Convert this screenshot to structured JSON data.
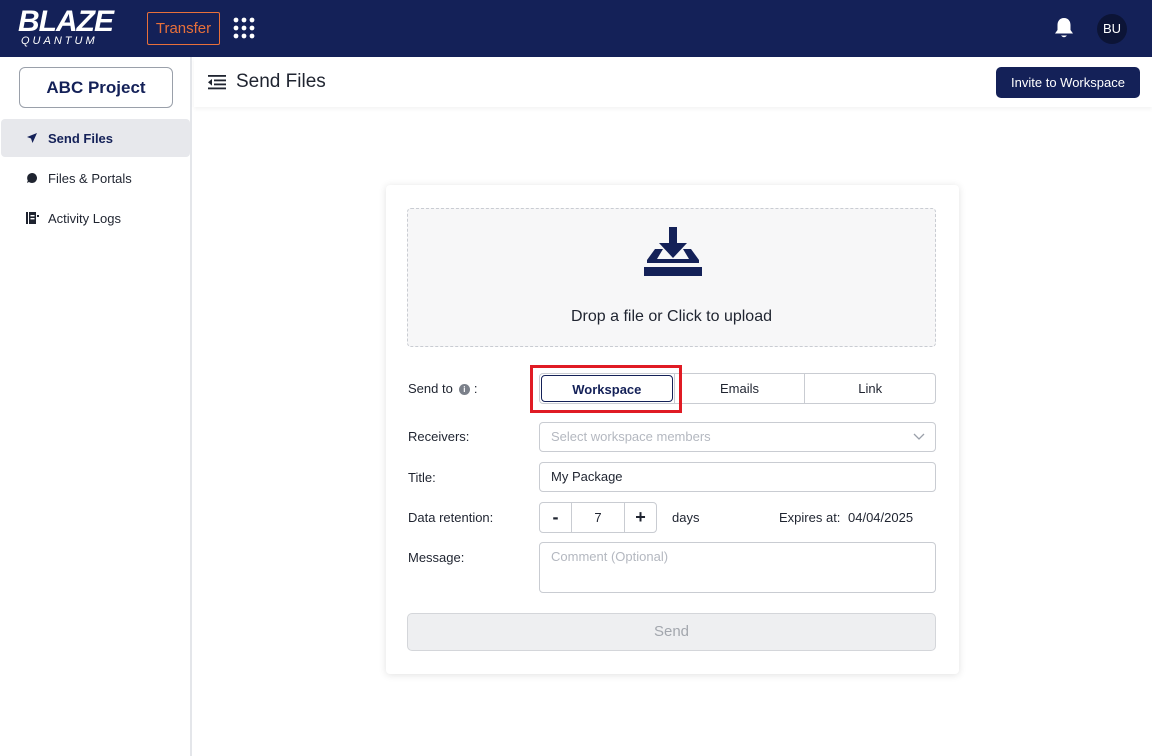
{
  "app": {
    "logo_main": "BLAZE",
    "logo_sub": "QUANTUM",
    "transfer_label": "Transfer",
    "user_initials": "BU",
    "accent_color": "#e8703a",
    "brand_color": "#142158"
  },
  "sidebar": {
    "project_label": "ABC Project",
    "items": [
      {
        "label": "Send Files",
        "icon": "send-icon",
        "active": true
      },
      {
        "label": "Files & Portals",
        "icon": "chat-bubble-icon",
        "active": false
      },
      {
        "label": "Activity Logs",
        "icon": "logs-icon",
        "active": false
      }
    ]
  },
  "header": {
    "title": "Send Files",
    "invite_label": "Invite to Workspace"
  },
  "upload": {
    "drop_text": "Drop a file or Click to upload",
    "icon": "download-tray-icon"
  },
  "form": {
    "send_to_label": "Send to",
    "send_to_colon": ":",
    "send_to_options": [
      "Workspace",
      "Emails",
      "Link"
    ],
    "send_to_selected": "Workspace",
    "receivers_label": "Receivers:",
    "receivers_placeholder": "Select workspace members",
    "title_label": "Title:",
    "title_value": "My Package",
    "retention_label": "Data retention:",
    "retention_minus": "-",
    "retention_value": "7",
    "retention_plus": "+",
    "retention_unit": "days",
    "expires_label": "Expires at:",
    "expires_value": "04/04/2025",
    "message_label": "Message:",
    "message_placeholder": "Comment (Optional)",
    "send_label": "Send"
  }
}
